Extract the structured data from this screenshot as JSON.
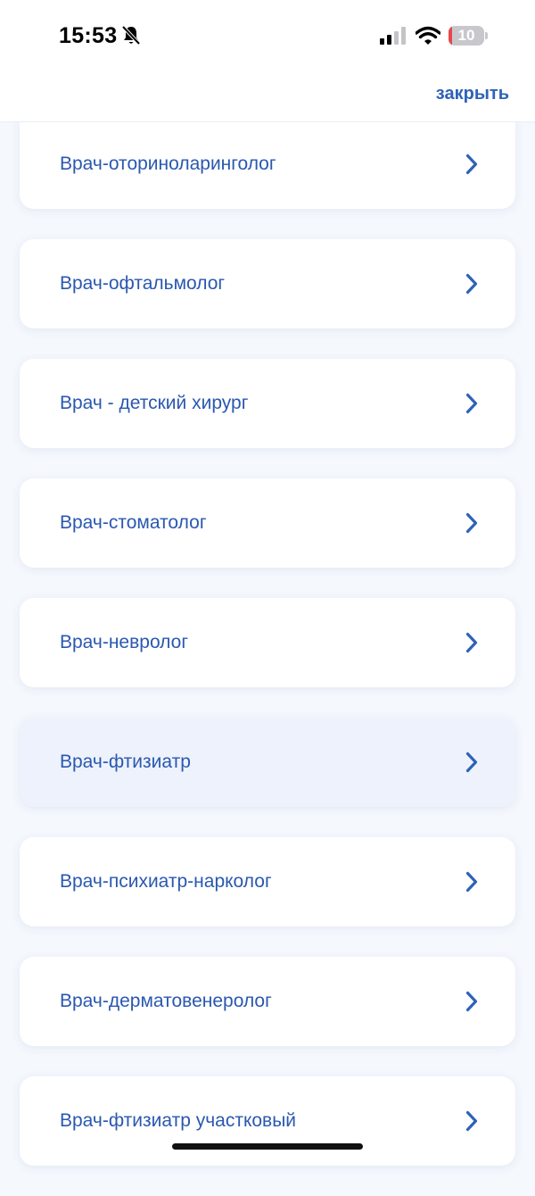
{
  "status_bar": {
    "time": "15:53",
    "battery": "10",
    "battery_level": 0.1,
    "icons": [
      "bell-slash-icon",
      "signal-icon",
      "wifi-icon",
      "battery-icon"
    ]
  },
  "nav": {
    "close_label": "закрыть"
  },
  "list": {
    "items": [
      {
        "label": "Врач-оториноларинголог"
      },
      {
        "label": "Врач-офтальмолог"
      },
      {
        "label": "Врач - детский хирург"
      },
      {
        "label": "Врач-стоматолог"
      },
      {
        "label": "Врач-невролог"
      },
      {
        "label": "Врач-фтизиатр",
        "highlighted": true
      },
      {
        "label": "Врач-психиатр-нарколог"
      },
      {
        "label": "Врач-дерматовенеролог"
      },
      {
        "label": "Врач-фтизиатр участковый"
      }
    ]
  },
  "colors": {
    "accent": "#2e62b8",
    "page_background": "#f5f8fd",
    "card_background": "#ffffff",
    "highlight_background": "#edf2fd",
    "battery_low": "#e5484d"
  }
}
